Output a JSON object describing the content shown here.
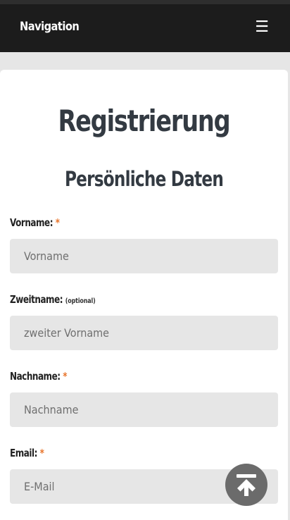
{
  "nav": {
    "title": "Navigation",
    "menu_icon": "hamburger-icon"
  },
  "form": {
    "title": "Registrierung",
    "section_title": "Persönliche Daten",
    "required_marker": "*",
    "fields": [
      {
        "label": "Vorname:",
        "required": true,
        "placeholder": "Vorname",
        "value": ""
      },
      {
        "label": "Zweitname:",
        "optional_note": "(optional)",
        "required": false,
        "placeholder": "zweiter Vorname",
        "value": ""
      },
      {
        "label": "Nachname:",
        "required": true,
        "placeholder": "Nachname",
        "value": ""
      },
      {
        "label": "Email:",
        "required": true,
        "placeholder": "E-Mail",
        "value": ""
      }
    ]
  },
  "scroll_top": {
    "icon": "arrow-up-to-top-icon"
  },
  "colors": {
    "navbar": "#1c1c1c",
    "required_marker": "#e8742b",
    "input_bg": "#e6e6e6",
    "heading": "#333a42"
  }
}
